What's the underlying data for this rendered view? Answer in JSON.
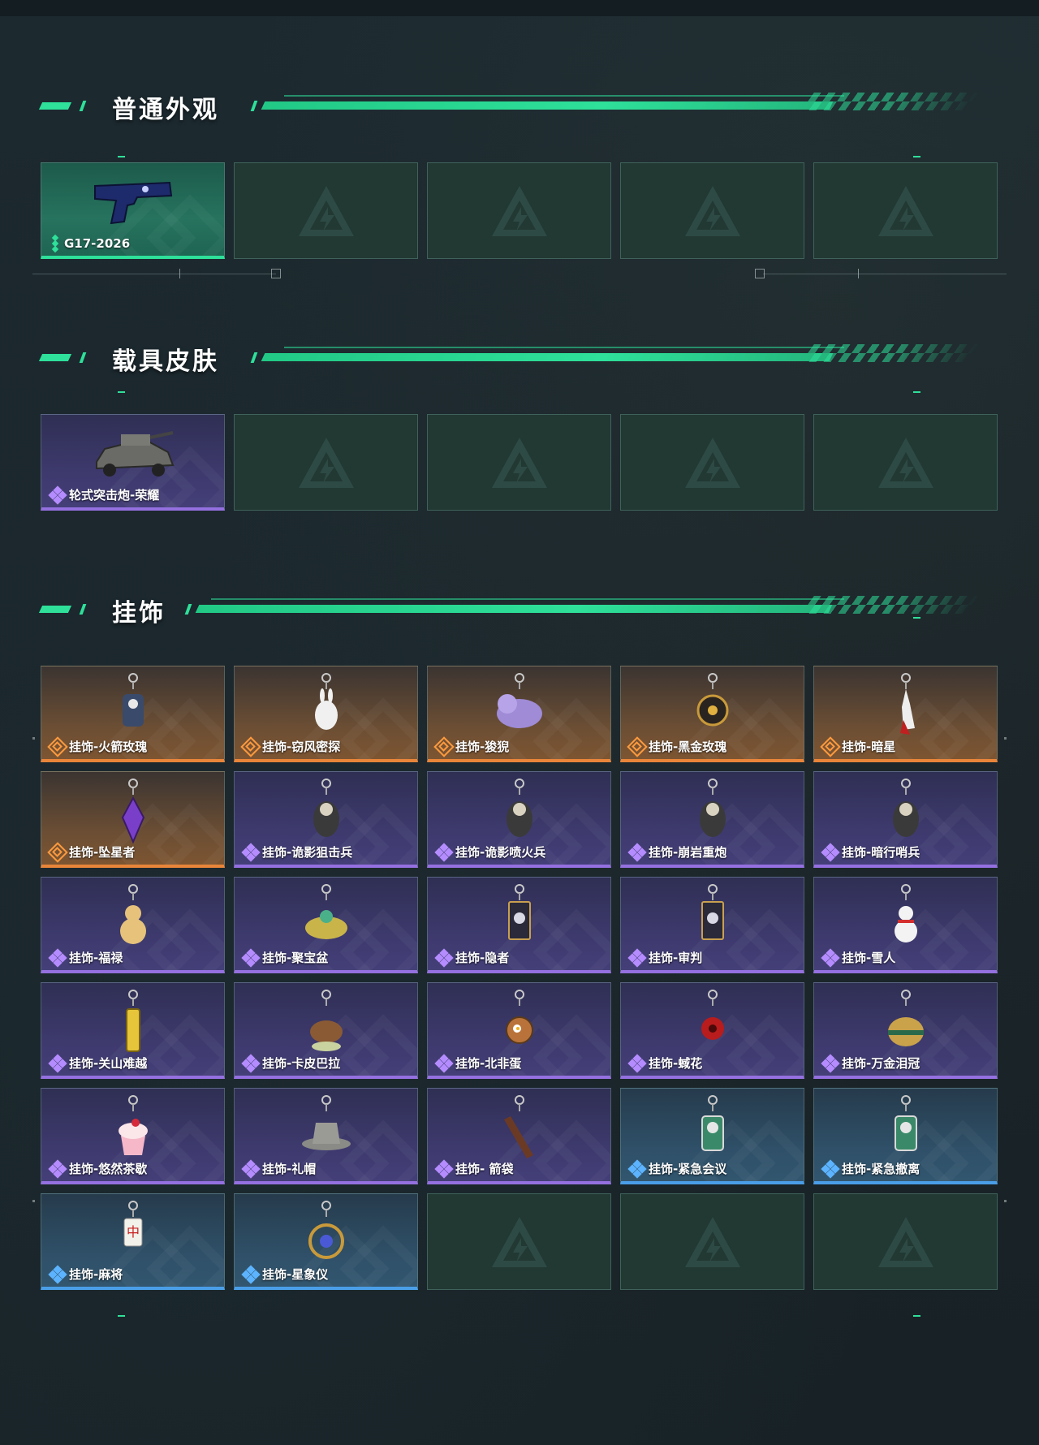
{
  "sections": [
    {
      "title": "普通外观",
      "items": [
        {
          "label": "G17-2026",
          "rarity": "green",
          "icon": "pistol"
        },
        {
          "empty": true
        },
        {
          "empty": true
        },
        {
          "empty": true
        },
        {
          "empty": true
        }
      ]
    },
    {
      "title": "载具皮肤",
      "items": [
        {
          "label": "轮式突击炮-荣耀",
          "rarity": "purple",
          "icon": "armored-vehicle"
        },
        {
          "empty": true
        },
        {
          "empty": true
        },
        {
          "empty": true
        },
        {
          "empty": true
        }
      ]
    },
    {
      "title": "挂饰",
      "items": [
        {
          "label": "挂饰-火箭玫瑰",
          "rarity": "orange",
          "icon": "robot-charm"
        },
        {
          "label": "挂饰-窃风密探",
          "rarity": "orange",
          "icon": "rabbit-charm"
        },
        {
          "label": "挂饰-狻猊",
          "rarity": "orange",
          "icon": "lion-charm"
        },
        {
          "label": "挂饰-黑金玫瑰",
          "rarity": "orange",
          "icon": "emblem-charm"
        },
        {
          "label": "挂饰-暗星",
          "rarity": "orange",
          "icon": "crane-charm"
        },
        {
          "label": "挂饰-坠星者",
          "rarity": "orange",
          "icon": "crystal-charm"
        },
        {
          "label": "挂饰-诡影狙击兵",
          "rarity": "purple",
          "icon": "soldier-charm"
        },
        {
          "label": "挂饰-诡影喷火兵",
          "rarity": "purple",
          "icon": "soldier-charm"
        },
        {
          "label": "挂饰-崩岩重炮",
          "rarity": "purple",
          "icon": "soldier-charm"
        },
        {
          "label": "挂饰-暗行哨兵",
          "rarity": "purple",
          "icon": "soldier-charm"
        },
        {
          "label": "挂饰-福禄",
          "rarity": "purple",
          "icon": "gourd-charm"
        },
        {
          "label": "挂饰-聚宝盆",
          "rarity": "purple",
          "icon": "treasure-bowl-charm"
        },
        {
          "label": "挂饰-隐者",
          "rarity": "purple",
          "icon": "card-charm"
        },
        {
          "label": "挂饰-审判",
          "rarity": "purple",
          "icon": "card-charm"
        },
        {
          "label": "挂饰-雪人",
          "rarity": "purple",
          "icon": "snowman-charm"
        },
        {
          "label": "挂饰-关山难越",
          "rarity": "purple",
          "icon": "tube-charm"
        },
        {
          "label": "挂饰-卡皮巴拉",
          "rarity": "purple",
          "icon": "capybara-charm"
        },
        {
          "label": "挂饰-北非蛋",
          "rarity": "purple",
          "icon": "pan-charm"
        },
        {
          "label": "挂饰-蜮花",
          "rarity": "purple",
          "icon": "flower-charm"
        },
        {
          "label": "挂饰-万金泪冠",
          "rarity": "purple",
          "icon": "crown-charm"
        },
        {
          "label": "挂饰-悠然茶歇",
          "rarity": "purple",
          "icon": "cupcake-charm"
        },
        {
          "label": "挂饰-礼帽",
          "rarity": "purple",
          "icon": "hat-charm"
        },
        {
          "label": "挂饰- 箭袋",
          "rarity": "purple",
          "icon": "quiver-charm"
        },
        {
          "label": "挂饰-紧急会议",
          "rarity": "blue",
          "icon": "figure-charm"
        },
        {
          "label": "挂饰-紧急撤离",
          "rarity": "blue",
          "icon": "figure-charm"
        },
        {
          "label": "挂饰-麻将",
          "rarity": "blue",
          "icon": "mahjong-charm"
        },
        {
          "label": "挂饰-星象仪",
          "rarity": "blue",
          "icon": "astrolabe-charm"
        },
        {
          "empty": true
        },
        {
          "empty": true
        },
        {
          "empty": true
        }
      ]
    }
  ],
  "colors": {
    "accent": "#2ee09a",
    "green": "#2ee09a",
    "purple": "#9470e0",
    "orange": "#e8853a",
    "blue": "#4a9ee8",
    "empty_logo": "#2d4a44"
  }
}
